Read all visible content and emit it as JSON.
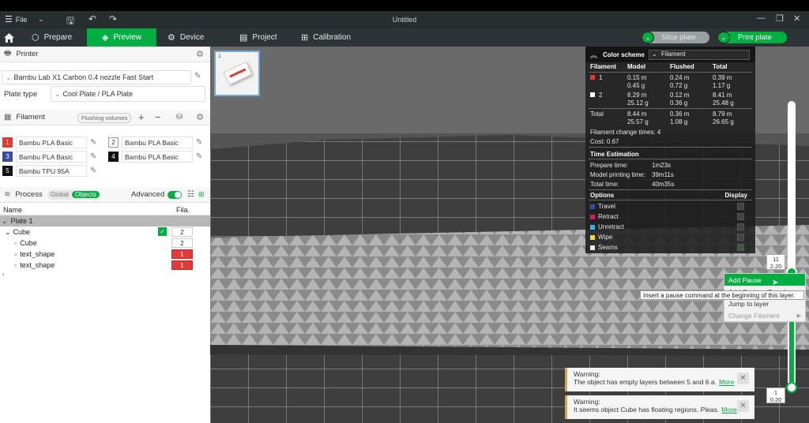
{
  "window": {
    "title": "Untitled",
    "file_menu": "File"
  },
  "nav": {
    "home": "home",
    "tabs": [
      "Prepare",
      "Preview",
      "Device",
      "Project",
      "Calibration"
    ],
    "active": "Preview",
    "slice_label": "Slice plate",
    "print_label": "Print plate"
  },
  "printer": {
    "header": "Printer",
    "preset": "Bambu Lab X1 Carbon 0.4 nozzle Fast Start",
    "plate_type_label": "Plate type",
    "plate_type": "Cool Plate / PLA Plate"
  },
  "filament": {
    "header": "Filament",
    "flushing_label": "Flushing volumes",
    "items": [
      {
        "num": "1",
        "name": "Bambu PLA Basic",
        "color": "#e53935"
      },
      {
        "num": "2",
        "name": "Bambu PLA Basic",
        "color": "#ffffff"
      },
      {
        "num": "3",
        "name": "Bambu PLA Basic",
        "color": "#3949ab"
      },
      {
        "num": "4",
        "name": "Bambu PLA Basic",
        "color": "#111111"
      },
      {
        "num": "5",
        "name": "Bambu TPU 95A",
        "color": "#111111"
      }
    ]
  },
  "process": {
    "header": "Process",
    "global_label": "Global",
    "objects_label": "Objects",
    "advanced_label": "Advanced"
  },
  "objects": {
    "col_name": "Name",
    "col_fila": "Fila.",
    "plate": "Plate 1",
    "rows": [
      {
        "name": "Cube",
        "fila": "2"
      },
      {
        "name": "Cube",
        "fila": "2"
      },
      {
        "name": "text_shape",
        "fila": "1"
      },
      {
        "name": "text_shape",
        "fila": "1"
      }
    ]
  },
  "thumbnail": {
    "plate_num": "1"
  },
  "stats": {
    "color_scheme_label": "Color scheme",
    "color_scheme_value": "Filament",
    "cols": [
      "Filament",
      "Model",
      "Flushed",
      "Total"
    ],
    "rows": [
      {
        "f": "1",
        "color": "#e53935",
        "model": [
          "0.15 m",
          "0.45 g"
        ],
        "flushed": [
          "0.24 m",
          "0.72 g"
        ],
        "total": [
          "0.39 m",
          "1.17 g"
        ]
      },
      {
        "f": "2",
        "color": "#ffffff",
        "model": [
          "8.29 m",
          "25.12 g"
        ],
        "flushed": [
          "0.12 m",
          "0.36 g"
        ],
        "total": [
          "8.41 m",
          "25.48 g"
        ]
      }
    ],
    "total_row": {
      "label": "Total",
      "model": [
        "8.44 m",
        "25.57 g"
      ],
      "flushed": [
        "0.36 m",
        "1.08 g"
      ],
      "total": [
        "8.79 m",
        "26.65 g"
      ]
    },
    "change_times": "Filament change times:  4",
    "cost": "Cost:  0.67",
    "time_header": "Time Estimation",
    "prepare_label": "Prepare time:",
    "prepare": "1m23s",
    "model_label": "Model printing time:",
    "model": "39m11s",
    "total_label": "Total time:",
    "total": "40m35s",
    "options_label": "Options",
    "display_label": "Display",
    "options": [
      {
        "name": "Travel",
        "color": "#3949ab"
      },
      {
        "name": "Retract",
        "color": "#d81b60"
      },
      {
        "name": "Unretract",
        "color": "#29b6f6"
      },
      {
        "name": "Wipe",
        "color": "#fdd835"
      },
      {
        "name": "Seams",
        "color": "#eeeeee"
      }
    ]
  },
  "layer_slider": {
    "top_layer": "11",
    "top_height": "2.20",
    "bottom_layer": "1",
    "bottom_height": "0.20"
  },
  "context_menu": {
    "items": [
      "Add Pause",
      "Add Custom G-code",
      "Jump to layer",
      "Change Filament"
    ]
  },
  "tooltip": "Insert a pause command at the beginning of this layer.",
  "warnings": [
    {
      "title": "Warning:",
      "text": "The object has empty layers between 5 and 6 a.",
      "more": "More"
    },
    {
      "title": "Warning:",
      "text": "It seems object Cube has floating regions. Pleas.",
      "more": "More"
    }
  ]
}
